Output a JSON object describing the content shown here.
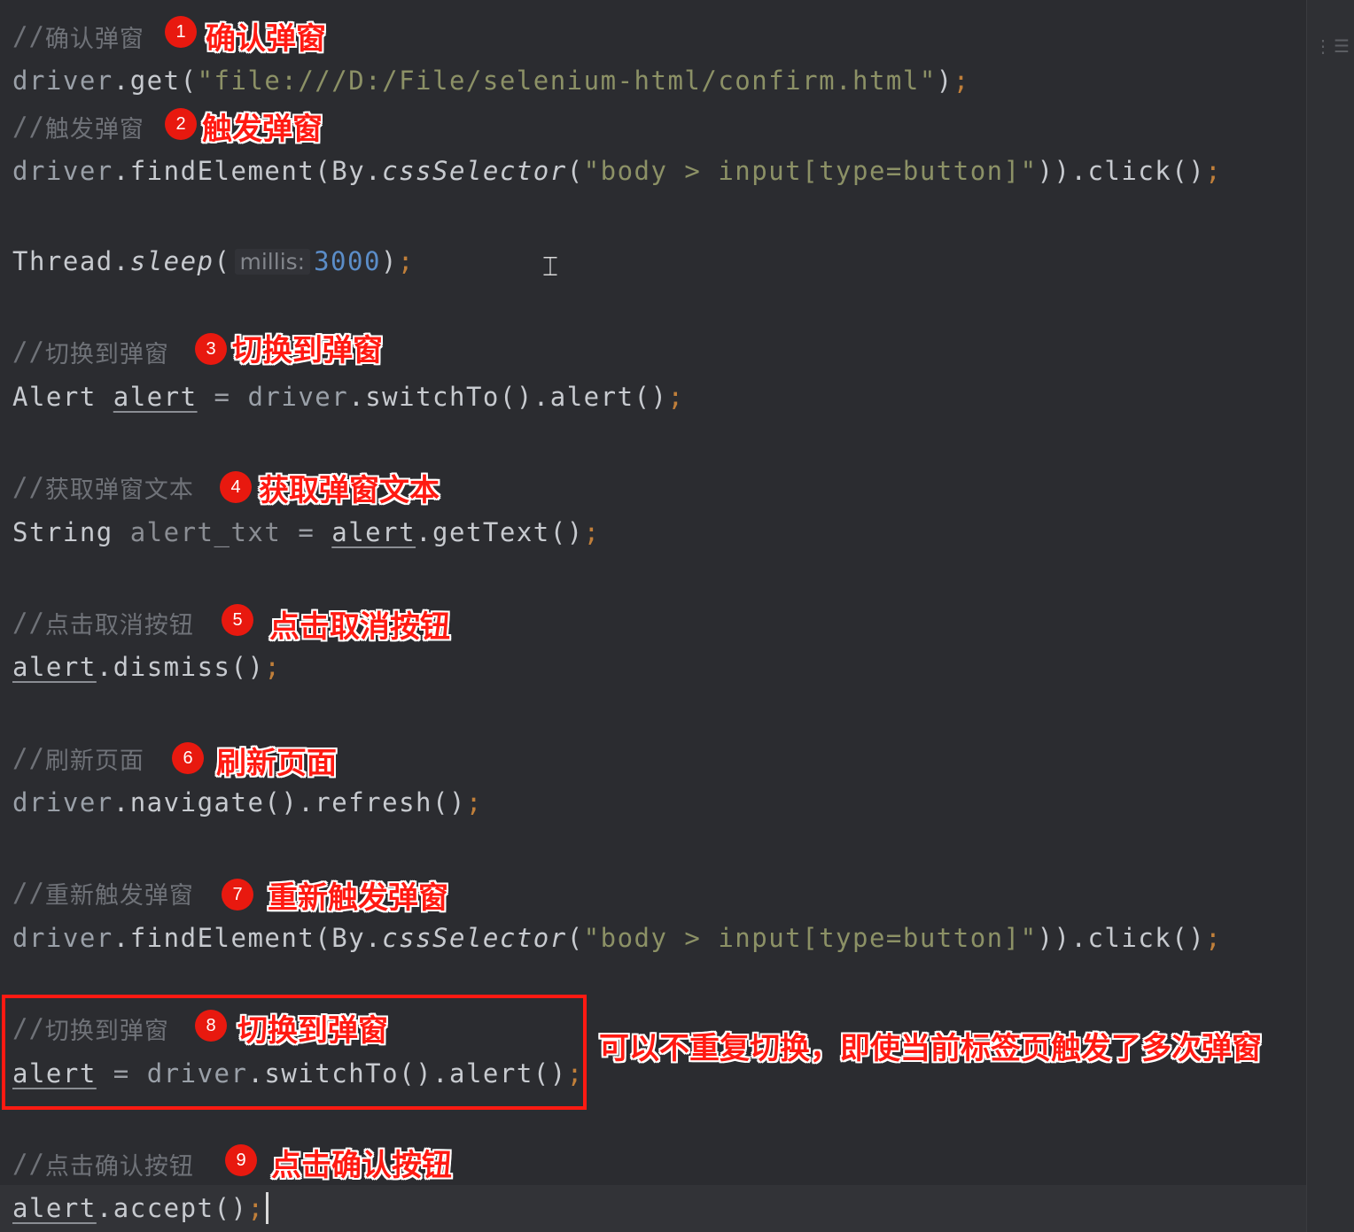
{
  "comments": {
    "c1": "确认弹窗",
    "c2": "触发弹窗",
    "c3": "切换到弹窗",
    "c4": "获取弹窗文本",
    "c5": "点击取消按钮",
    "c6": "刷新页面",
    "c7": "重新触发弹窗",
    "c8": "切换到弹窗",
    "c9": "点击确认按钮"
  },
  "code": {
    "l1_obj": "driver",
    "l1_method": ".get(",
    "l1_str": "\"file:///D:/File/selenium-html/confirm.html\"",
    "l1_close": ")",
    "l2_obj": "driver",
    "l2_method": ".findElement(By.",
    "l2_static": "cssSelector",
    "l2_paren": "(",
    "l2_str": "\"body > input[type=button]\"",
    "l2_close": ")).click()",
    "l3_class": "Thread.",
    "l3_static": "sleep",
    "l3_paren": "(",
    "l3_hint": "millis:",
    "l3_num": "3000",
    "l3_close": ")",
    "l4_type": "Alert ",
    "l4_var": "alert",
    "l4_eq": " = ",
    "l4_obj": "driver",
    "l4_rest": ".switchTo().alert()",
    "l5_type": "String ",
    "l5_var": "alert_txt",
    "l5_eq": " = ",
    "l5_obj": "alert",
    "l5_rest": ".getText()",
    "l6_obj": "alert",
    "l6_rest": ".dismiss()",
    "l7_obj": "driver",
    "l7_rest": ".navigate().refresh()",
    "l8_obj": "driver",
    "l8_method": ".findElement(By.",
    "l8_static": "cssSelector",
    "l8_paren": "(",
    "l8_str": "\"body > input[type=button]\"",
    "l8_close": ")).click()",
    "l9_var": "alert",
    "l9_eq": " = ",
    "l9_obj": "driver",
    "l9_rest": ".switchTo().alert()",
    "l10_obj": "alert",
    "l10_rest": ".accept()",
    "semi": ";",
    "slash": "//"
  },
  "badges": [
    "1",
    "2",
    "3",
    "4",
    "5",
    "6",
    "7",
    "8",
    "9"
  ],
  "annotations": {
    "a1": "确认弹窗",
    "a2": "触发弹窗",
    "a3": "切换到弹窗",
    "a4": "获取弹窗文本",
    "a5": "点击取消按钮",
    "a6": "刷新页面",
    "a7": "重新触发弹窗",
    "a8": "切换到弹窗",
    "a9": "点击确认按钮",
    "side_note": "可以不重复切换，即使当前标签页触发了多次弹窗"
  },
  "colors": {
    "annotation_red": "#ff1a12",
    "background": "#2b2c30"
  }
}
